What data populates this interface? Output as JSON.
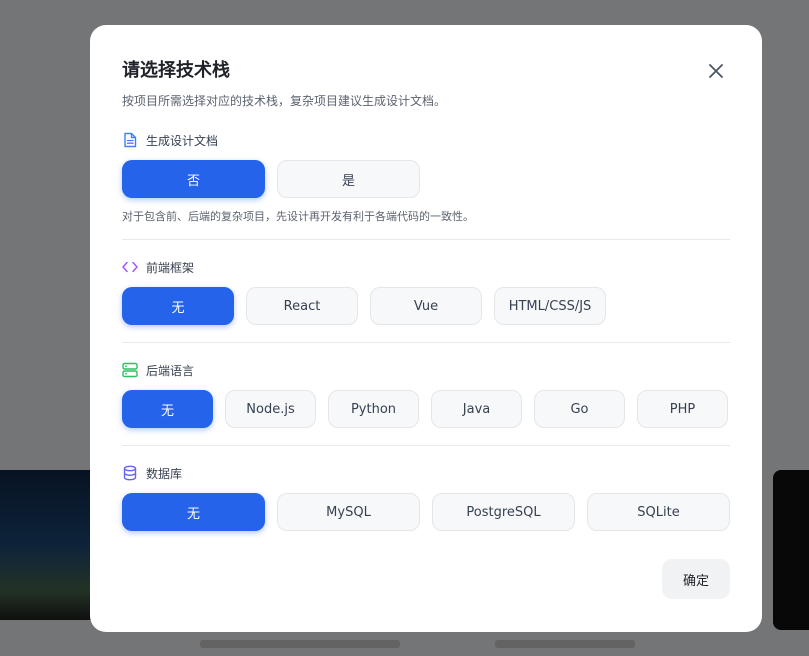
{
  "modal": {
    "title": "请选择技术栈",
    "description": "按项目所需选择对应的技术栈，复杂项目建议生成设计文档。",
    "confirm_label": "确定"
  },
  "sections": {
    "design_doc": {
      "label": "生成设计文档",
      "icon": "document-icon",
      "options": [
        "否",
        "是"
      ],
      "selected": "否",
      "hint": "对于包含前、后端的复杂项目，先设计再开发有利于各端代码的一致性。"
    },
    "frontend": {
      "label": "前端框架",
      "icon": "code-icon",
      "options": [
        "无",
        "React",
        "Vue",
        "HTML/CSS/JS"
      ],
      "selected": "无"
    },
    "backend": {
      "label": "后端语言",
      "icon": "server-icon",
      "options": [
        "无",
        "Node.js",
        "Python",
        "Java",
        "Go",
        "PHP"
      ],
      "selected": "无"
    },
    "database": {
      "label": "数据库",
      "icon": "database-icon",
      "options": [
        "无",
        "MySQL",
        "PostgreSQL",
        "SQLite"
      ],
      "selected": "无"
    }
  },
  "colors": {
    "accent": "#2563eb",
    "doc_icon": "#3b82f6",
    "code_icon": "#a855f7",
    "server_icon": "#22c55e",
    "db_icon": "#6366f1"
  }
}
